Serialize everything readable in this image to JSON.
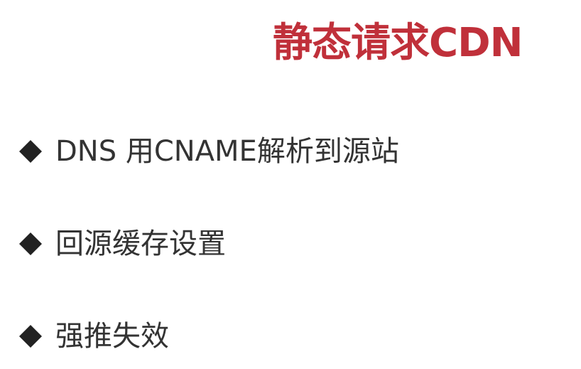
{
  "slide": {
    "title": "静态请求CDN",
    "title_color": "#c0303a",
    "bullet_icon": "diamond-icon",
    "bullets": [
      {
        "text": "DNS 用CNAME解析到源站"
      },
      {
        "text": "回源缓存设置"
      },
      {
        "text": "强推失效"
      }
    ]
  }
}
